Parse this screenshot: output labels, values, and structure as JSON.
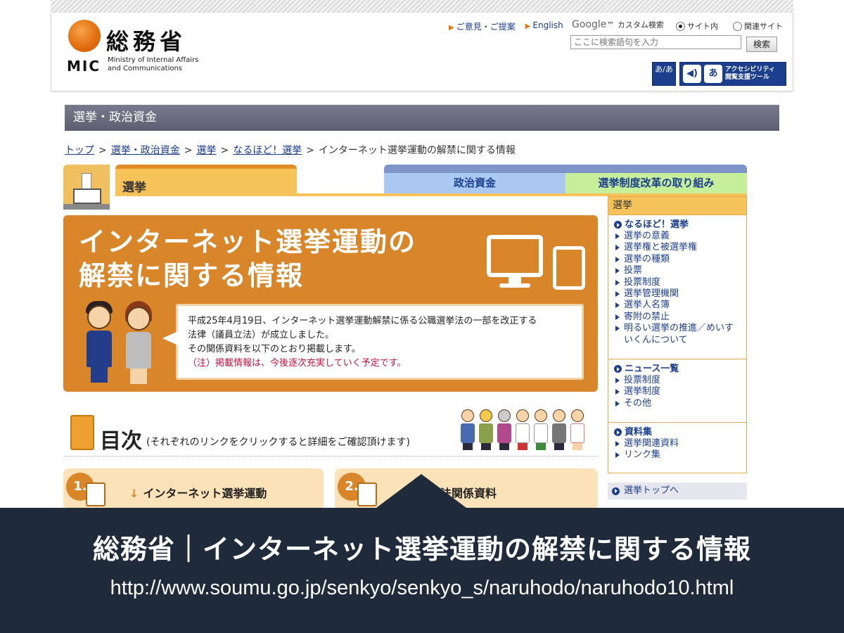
{
  "header": {
    "logo_jp": "総務省",
    "logo_abbr": "MIC",
    "logo_en_line1": "Ministry of Internal Affairs",
    "logo_en_line2": "and Communications",
    "link_feedback": "ご意見・ご提案",
    "link_english": "English",
    "google_brand": "Google",
    "google_label": "カスタム検索",
    "radio_site": "サイト内",
    "radio_related": "関連サイト",
    "search_placeholder": "ここに検索語句を入力",
    "search_button": "検索",
    "fontsize_label": "あ/あ",
    "access_icon": "あ",
    "access_line1": "アクセシビリティ",
    "access_line2": "閲覧支援ツール"
  },
  "category_bar": "選挙・政治資金",
  "breadcrumb": {
    "items": [
      "トップ",
      "選挙・政治資金",
      "選挙",
      "なるほど！選挙"
    ],
    "separator": ">",
    "current": "インターネット選挙運動の解禁に関する情報"
  },
  "tabs": {
    "senkyo": "選挙",
    "seiji": "政治資金",
    "kaikaku": "選挙制度改革の取り組み"
  },
  "banner": {
    "title_line1": "インターネット選挙運動の",
    "title_line2": "解禁に関する情報",
    "text_line1": "平成25年4月19日、インターネット選挙運動解禁に係る公職選挙法の一部を改正する",
    "text_line2": "法律（議員立法）が成立しました。",
    "text_line3": "その関係資料を以下のとおり掲載します。",
    "note": "（注）掲載情報は、今後逐次充実していく予定です。"
  },
  "toc": {
    "title": "目次",
    "subtitle": "(それぞれのリンクをクリックすると詳細をご確認頂けます)"
  },
  "cards": [
    {
      "num": "1.",
      "label": "インターネット選挙運動",
      "arrow": "↓"
    },
    {
      "num": "2.",
      "label": "法関係資料"
    }
  ],
  "sidebar": {
    "head": "選挙",
    "groups": [
      {
        "title": "なるほど！選挙",
        "items": [
          "選挙の意義",
          "選挙権と被選挙権",
          "選挙の種類",
          "投票",
          "投票制度",
          "選挙管理機関",
          "選挙人名簿",
          "寄附の禁止",
          "明るい選挙の推進／めいすいくんについて"
        ]
      },
      {
        "title": "ニュース一覧",
        "items": [
          "投票制度",
          "選挙制度",
          "その他"
        ]
      },
      {
        "title": "資料集",
        "items": [
          "選挙関連資料",
          "リンク集"
        ]
      }
    ],
    "top_link": "選挙トップへ"
  },
  "caption": {
    "title": "総務省｜インターネット選挙運動の解禁に関する情報",
    "url": "http://www.soumu.go.jp/senkyo/senkyo_s/naruhodo/naruhodo10.html"
  },
  "colors": {
    "accent_orange": "#d9852a",
    "nav_blue": "#1b3f8c",
    "caption_bg": "#1f2a3a"
  }
}
